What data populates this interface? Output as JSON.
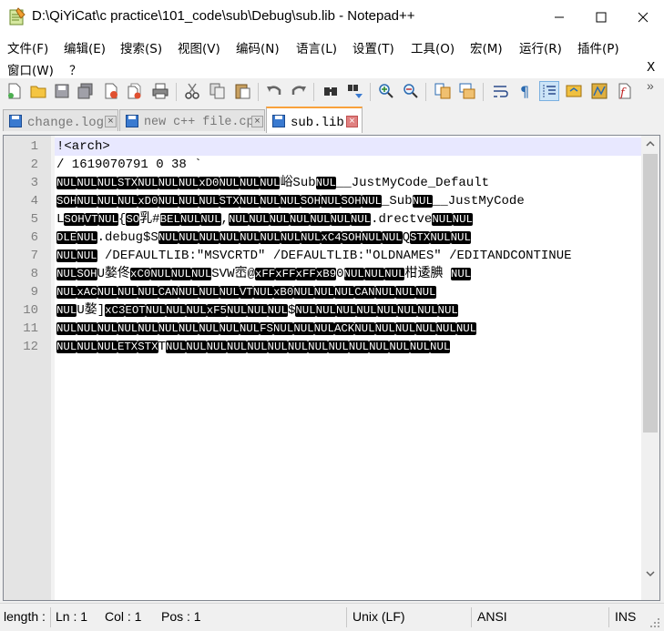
{
  "window": {
    "title": "D:\\QiYiCat\\c practice\\101_code\\sub\\Debug\\sub.lib - Notepad++",
    "minimize_icon": "minimize-icon",
    "maximize_icon": "maximize-icon",
    "close_icon": "close-icon"
  },
  "menu": {
    "row1": [
      "文件(F)",
      "编辑(E)",
      "搜索(S)",
      "视图(V)",
      "编码(N)",
      "语言(L)",
      "设置(T)",
      "工具(O)",
      "宏(M)",
      "运行(R)",
      "插件(P)"
    ],
    "row2": [
      "窗口(W)",
      "？"
    ],
    "close_doc": "X"
  },
  "tabs": [
    {
      "label": "change.log",
      "active": false
    },
    {
      "label": "new c++ file.cpp",
      "active": false
    },
    {
      "label": "sub.lib",
      "active": true
    }
  ],
  "editor": {
    "line_numbers": [
      "1",
      "2",
      "3",
      "4",
      "5",
      "6",
      "7",
      "8",
      "9",
      "10",
      "11",
      "12"
    ],
    "current_line": 1,
    "lines": [
      [
        [
          "t",
          "!<arch>"
        ]
      ],
      [
        [
          "t",
          "/               1619070791              0       38        `"
        ]
      ],
      [
        [
          "c",
          "NUL"
        ],
        [
          "c",
          "NUL"
        ],
        [
          "c",
          "NUL"
        ],
        [
          "c",
          "STX"
        ],
        [
          "c",
          "NUL"
        ],
        [
          "c",
          "NUL"
        ],
        [
          "c",
          "NUL"
        ],
        [
          "c",
          "xD0"
        ],
        [
          "c",
          "NUL"
        ],
        [
          "c",
          "NUL"
        ],
        [
          "c",
          "NUL"
        ],
        [
          "t",
          "峪Sub"
        ],
        [
          "c",
          "NUL"
        ],
        [
          "t",
          "__JustMyCode_Default"
        ]
      ],
      [
        [
          "c",
          "SOH"
        ],
        [
          "c",
          "NUL"
        ],
        [
          "c",
          "NUL"
        ],
        [
          "c",
          "NUL"
        ],
        [
          "c",
          "xD0"
        ],
        [
          "c",
          "NUL"
        ],
        [
          "c",
          "NUL"
        ],
        [
          "c",
          "NUL"
        ],
        [
          "c",
          "STX"
        ],
        [
          "c",
          "NUL"
        ],
        [
          "c",
          "NUL"
        ],
        [
          "c",
          "NUL"
        ],
        [
          "c",
          "SOH"
        ],
        [
          "c",
          "NUL"
        ],
        [
          "c",
          "SOH"
        ],
        [
          "c",
          "NUL"
        ],
        [
          "t",
          "_Sub"
        ],
        [
          "c",
          "NUL"
        ],
        [
          "t",
          "__JustMyCode"
        ]
      ],
      [
        [
          "t",
          "L"
        ],
        [
          "c",
          "SOH"
        ],
        [
          "c",
          "VT"
        ],
        [
          "c",
          "NUL"
        ],
        [
          "t",
          "{"
        ],
        [
          "c",
          "SO"
        ],
        [
          "t",
          "乳#"
        ],
        [
          "c",
          "BEL"
        ],
        [
          "c",
          "NUL"
        ],
        [
          "c",
          "NUL"
        ],
        [
          "t",
          ","
        ],
        [
          "c",
          "NUL"
        ],
        [
          "c",
          "NUL"
        ],
        [
          "c",
          "NUL"
        ],
        [
          "c",
          "NUL"
        ],
        [
          "c",
          "NUL"
        ],
        [
          "c",
          "NUL"
        ],
        [
          "c",
          "NUL"
        ],
        [
          "t",
          ".drectve"
        ],
        [
          "c",
          "NUL"
        ],
        [
          "c",
          "NUL"
        ]
      ],
      [
        [
          "c",
          "DLE"
        ],
        [
          "c",
          "NUL"
        ],
        [
          "t",
          ".debug$S"
        ],
        [
          "c",
          "NUL"
        ],
        [
          "c",
          "NUL"
        ],
        [
          "c",
          "NUL"
        ],
        [
          "c",
          "NUL"
        ],
        [
          "c",
          "NUL"
        ],
        [
          "c",
          "NUL"
        ],
        [
          "c",
          "NUL"
        ],
        [
          "c",
          "NUL"
        ],
        [
          "c",
          "xC4"
        ],
        [
          "c",
          "SOH"
        ],
        [
          "c",
          "NUL"
        ],
        [
          "c",
          "NUL"
        ],
        [
          "t",
          "Q"
        ],
        [
          "c",
          "STX"
        ],
        [
          "c",
          "NUL"
        ],
        [
          "c",
          "NUL"
        ]
      ],
      [
        [
          "c",
          "NUL"
        ],
        [
          "c",
          "NUL"
        ],
        [
          "t",
          "   /DEFAULTLIB:\"MSVCRTD\" /DEFAULTLIB:\"OLDNAMES\" /EDITANDCONTINUE"
        ]
      ],
      [
        [
          "c",
          "NUL"
        ],
        [
          "c",
          "SOH"
        ],
        [
          "t",
          "U嫯佟"
        ],
        [
          "c",
          "xC0"
        ],
        [
          "c",
          "NUL"
        ],
        [
          "c",
          "NUL"
        ],
        [
          "c",
          "NUL"
        ],
        [
          "t",
          "SVW崈@"
        ],
        [
          "c",
          "xFF"
        ],
        [
          "c",
          "xFF"
        ],
        [
          "c",
          "xFF"
        ],
        [
          "c",
          "xB9"
        ],
        [
          "t",
          "0"
        ],
        [
          "c",
          "NUL"
        ],
        [
          "c",
          "NUL"
        ],
        [
          "c",
          "NUL"
        ],
        [
          "t",
          "柑逶腆  "
        ],
        [
          "c",
          "NUL"
        ]
      ],
      [
        [
          "c",
          "NUL"
        ],
        [
          "c",
          "xAC"
        ],
        [
          "c",
          "NUL"
        ],
        [
          "c",
          "NUL"
        ],
        [
          "c",
          "NUL"
        ],
        [
          "c",
          "CAN"
        ],
        [
          "c",
          "NUL"
        ],
        [
          "c",
          "NUL"
        ],
        [
          "c",
          "NUL"
        ],
        [
          "c",
          "VT"
        ],
        [
          "c",
          "NUL"
        ],
        [
          "c",
          "xB0"
        ],
        [
          "c",
          "NUL"
        ],
        [
          "c",
          "NUL"
        ],
        [
          "c",
          "NUL"
        ],
        [
          "c",
          "CAN"
        ],
        [
          "c",
          "NUL"
        ],
        [
          "c",
          "NUL"
        ],
        [
          "c",
          "NUL"
        ]
      ],
      [
        [
          "c",
          "NUL"
        ],
        [
          "t",
          "U嫯]"
        ],
        [
          "c",
          "xC3"
        ],
        [
          "c",
          "EOT"
        ],
        [
          "c",
          "NUL"
        ],
        [
          "c",
          "NUL"
        ],
        [
          "c",
          "NUL"
        ],
        [
          "c",
          "xF5"
        ],
        [
          "c",
          "NUL"
        ],
        [
          "c",
          "NUL"
        ],
        [
          "c",
          "NUL"
        ],
        [
          "t",
          "$"
        ],
        [
          "c",
          "NUL"
        ],
        [
          "c",
          "NUL"
        ],
        [
          "c",
          "NUL"
        ],
        [
          "c",
          "NUL"
        ],
        [
          "c",
          "NUL"
        ],
        [
          "c",
          "NUL"
        ],
        [
          "c",
          "NUL"
        ],
        [
          "c",
          "NUL"
        ]
      ],
      [
        [
          "c",
          "NUL"
        ],
        [
          "c",
          "NUL"
        ],
        [
          "c",
          "NUL"
        ],
        [
          "c",
          "NUL"
        ],
        [
          "c",
          "NUL"
        ],
        [
          "c",
          "NUL"
        ],
        [
          "c",
          "NUL"
        ],
        [
          "c",
          "NUL"
        ],
        [
          "c",
          "NUL"
        ],
        [
          "c",
          "NUL"
        ],
        [
          "c",
          "FS"
        ],
        [
          "c",
          "NUL"
        ],
        [
          "c",
          "NUL"
        ],
        [
          "c",
          "NUL"
        ],
        [
          "c",
          "ACK"
        ],
        [
          "c",
          "NUL"
        ],
        [
          "c",
          "NUL"
        ],
        [
          "c",
          "NUL"
        ],
        [
          "c",
          "NUL"
        ],
        [
          "c",
          "NUL"
        ],
        [
          "c",
          "NUL"
        ]
      ],
      [
        [
          "c",
          "NUL"
        ],
        [
          "c",
          "NUL"
        ],
        [
          "c",
          "NUL"
        ],
        [
          "c",
          "ETX"
        ],
        [
          "c",
          "STX"
        ],
        [
          "t",
          "T"
        ],
        [
          "c",
          "NUL"
        ],
        [
          "c",
          "NUL"
        ],
        [
          "c",
          "NUL"
        ],
        [
          "c",
          "NUL"
        ],
        [
          "c",
          "NUL"
        ],
        [
          "c",
          "NUL"
        ],
        [
          "c",
          "NUL"
        ],
        [
          "c",
          "NUL"
        ],
        [
          "c",
          "NUL"
        ],
        [
          "c",
          "NUL"
        ],
        [
          "c",
          "NUL"
        ],
        [
          "c",
          "NUL"
        ],
        [
          "c",
          "NUL"
        ],
        [
          "c",
          "NUL"
        ]
      ]
    ]
  },
  "statusbar": {
    "length": "length :",
    "ln": "Ln : 1",
    "col": "Col : 1",
    "pos": "Pos : 1",
    "eol": "Unix (LF)",
    "encoding": "ANSI",
    "mode": "INS"
  },
  "colors": {
    "active_tab_accent": "#f9a13c",
    "current_line": "#e8e8ff",
    "control_char_bg": "#000000"
  },
  "toolbar_icons": [
    "new-file-icon",
    "open-file-icon",
    "save-icon",
    "save-all-icon",
    "close-icon",
    "close-all-icon",
    "print-icon",
    "cut-icon",
    "copy-icon",
    "paste-icon",
    "undo-icon",
    "redo-icon",
    "find-icon",
    "replace-icon",
    "zoom-in-icon",
    "zoom-out-icon",
    "sync-vertical-icon",
    "sync-horizontal-icon",
    "word-wrap-icon",
    "show-all-chars-icon",
    "indent-guide-icon",
    "doc-map-icon",
    "function-list-icon",
    "record-macro-icon"
  ]
}
